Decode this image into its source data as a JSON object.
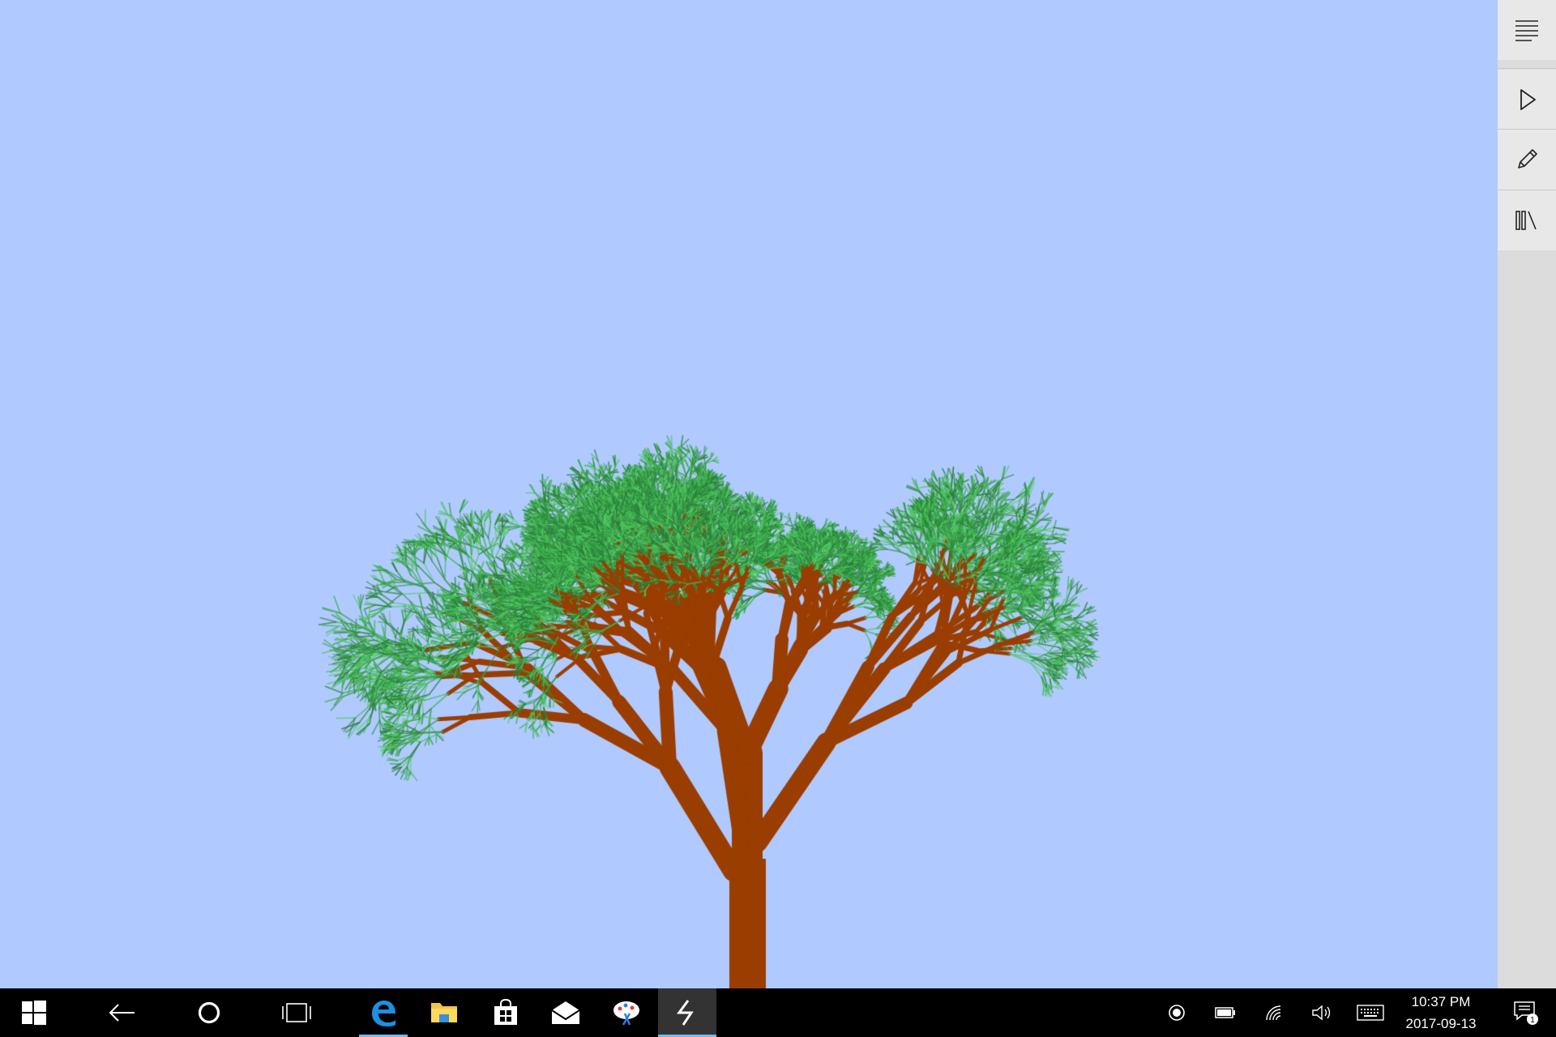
{
  "app": {
    "background_color": "#b0caff",
    "trunk_color": "#9a3d00",
    "foliage_colors": [
      "#2f8f3f",
      "#3fb34f",
      "#55c865",
      "#2a7d3a"
    ]
  },
  "toolbar": {
    "items": [
      {
        "icon": "text-align-icon"
      },
      {
        "icon": "play-icon"
      },
      {
        "icon": "pencil-icon"
      },
      {
        "icon": "library-icon"
      }
    ]
  },
  "taskbar": {
    "apps": [
      {
        "icon": "windows-start-icon"
      },
      {
        "icon": "back-arrow-icon"
      },
      {
        "icon": "cortana-icon"
      },
      {
        "icon": "task-view-icon"
      },
      {
        "icon": "edge-browser-icon",
        "accent": "#1e90e0"
      },
      {
        "icon": "file-explorer-icon",
        "accent": "#f3c44b"
      },
      {
        "icon": "store-icon"
      },
      {
        "icon": "mail-icon"
      },
      {
        "icon": "paint-icon"
      },
      {
        "icon": "tree-app-icon"
      }
    ],
    "tray": [
      {
        "icon": "record-icon"
      },
      {
        "icon": "battery-icon"
      },
      {
        "icon": "wifi-icon"
      },
      {
        "icon": "volume-icon"
      },
      {
        "icon": "keyboard-icon"
      }
    ],
    "time": "10:37 PM",
    "date": "2017-09-13",
    "notification_count": "1"
  }
}
